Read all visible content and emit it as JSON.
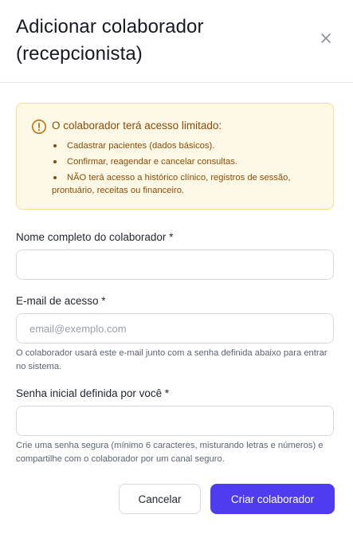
{
  "dialog": {
    "title": "Adicionar colaborador (recepcionista)",
    "close_icon": "close-icon"
  },
  "alert": {
    "icon": "alert-circle-icon",
    "title": "O colaborador terá acesso limitado:",
    "items": [
      "Cadastrar pacientes (dados básicos).",
      "Confirmar, reagendar e cancelar consultas.",
      "NÃO terá acesso a histórico clínico, registros de sessão, prontuário, receitas ou financeiro."
    ],
    "colors": {
      "background": "#fef9e6",
      "border": "#f5df8e",
      "text": "#8a4a08"
    }
  },
  "form": {
    "name": {
      "label": "Nome completo do colaborador *",
      "value": "",
      "placeholder": ""
    },
    "email": {
      "label": "E-mail de acesso *",
      "value": "",
      "placeholder": "email@exemplo.com",
      "help": "O colaborador usará este e-mail junto com a senha definida abaixo para entrar no sistema."
    },
    "password": {
      "label": "Senha inicial definida por você *",
      "value": "",
      "placeholder": "",
      "help": "Crie uma senha segura (mínimo 6 caracteres, misturando letras e números) e compartilhe com o colaborador por um canal seguro."
    }
  },
  "actions": {
    "cancel_label": "Cancelar",
    "submit_label": "Criar colaborador",
    "primary_color": "#4f3bf0"
  }
}
